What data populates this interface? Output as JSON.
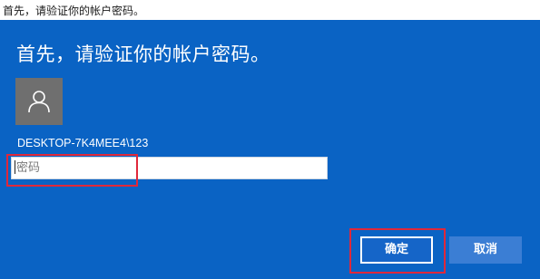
{
  "window": {
    "title": "首先，请验证你的帐户密码。"
  },
  "dialog": {
    "heading": "首先，请验证你的帐户密码。",
    "account_name": "DESKTOP-7K4MEE4\\123",
    "avatar_icon": "user-silhouette-icon",
    "password_placeholder": "密码",
    "ok_label": "确定",
    "cancel_label": "取消"
  },
  "colors": {
    "background": "#0a63c4",
    "avatar": "#6f6f6f",
    "highlight": "#e0283a"
  }
}
